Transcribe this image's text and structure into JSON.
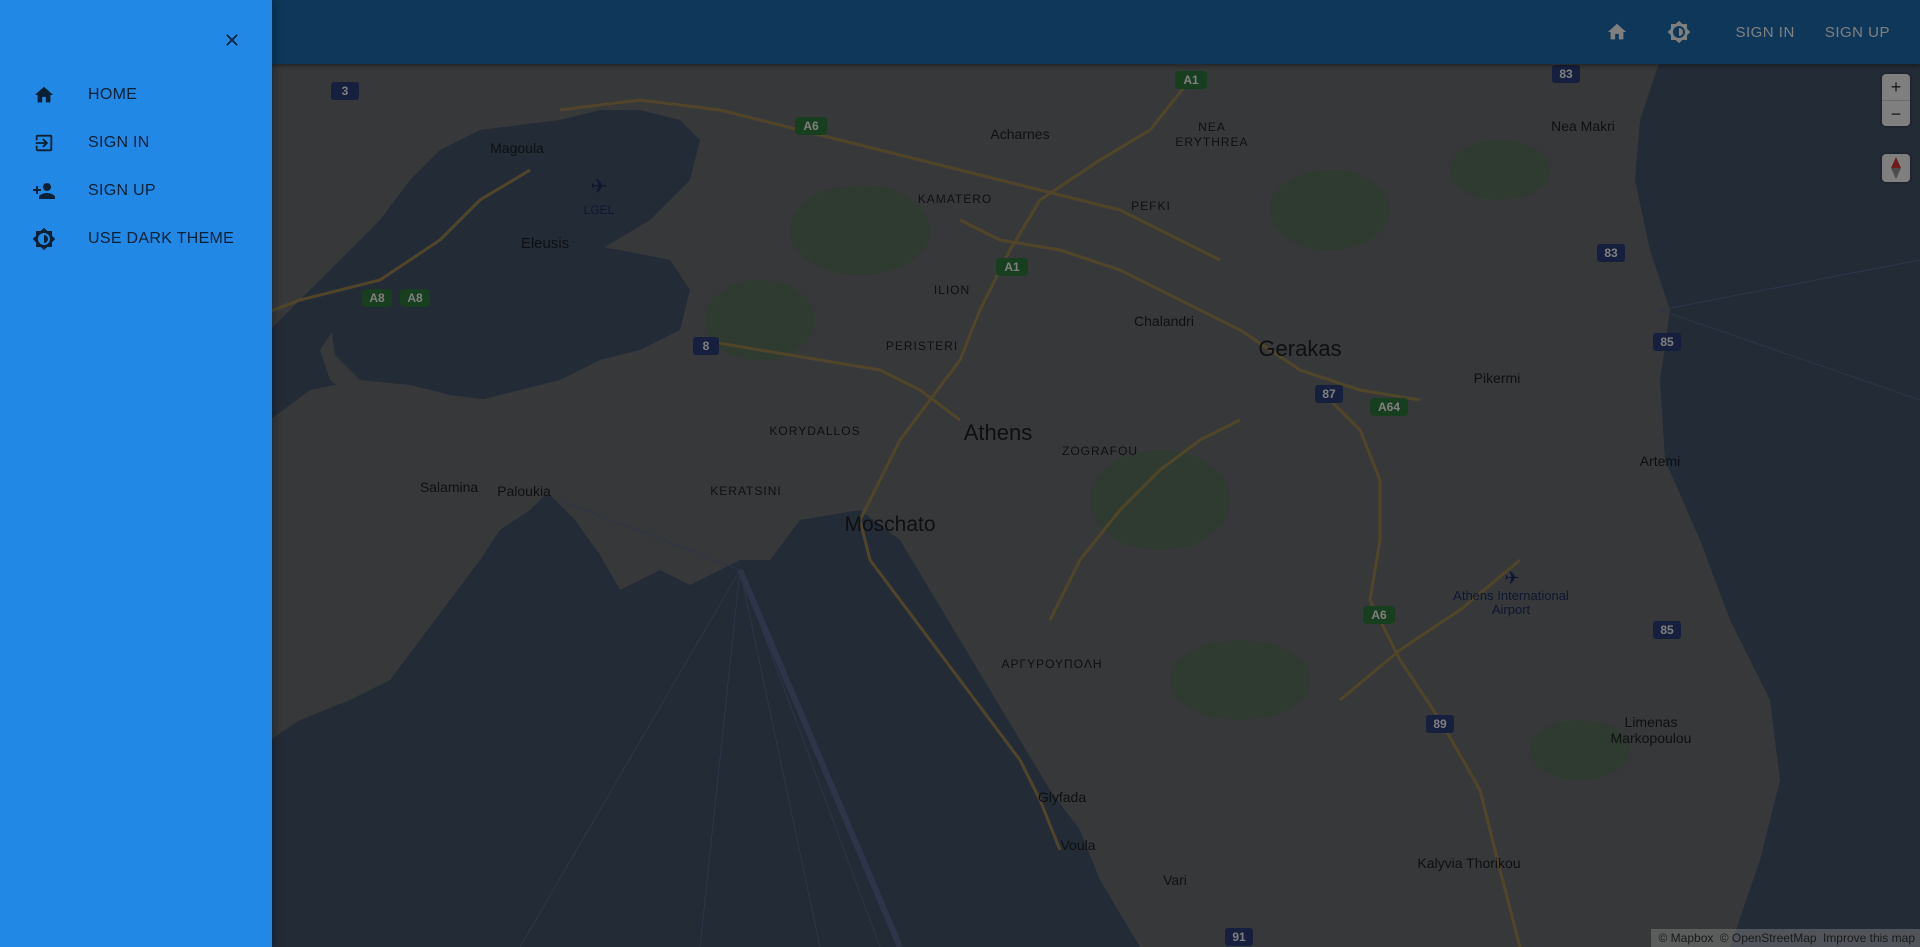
{
  "app_bar": {
    "home_icon": "home-icon",
    "theme_icon": "brightness-icon",
    "sign_in_label": "SIGN IN",
    "sign_up_label": "SIGN UP"
  },
  "drawer": {
    "close_icon": "close-icon",
    "items": [
      {
        "label": "HOME",
        "icon": "home-icon"
      },
      {
        "label": "SIGN IN",
        "icon": "login-icon"
      },
      {
        "label": "SIGN UP",
        "icon": "person-add-icon"
      },
      {
        "label": "USE DARK THEME",
        "icon": "brightness-icon"
      }
    ]
  },
  "map": {
    "zoom_in_label": "+",
    "zoom_out_label": "−",
    "attribution": [
      "© Mapbox",
      "© OpenStreetMap",
      "Improve this map"
    ],
    "places": {
      "athens": "Athens",
      "moschato": "Moschato",
      "gerakas": "Gerakas",
      "acharnes": "Acharnes",
      "nea_erythrea_1": "NEA",
      "nea_erythrea_2": "ERYTHREA",
      "nea_makri": "Nea Makri",
      "magoula": "Magoula",
      "lgel": "LGEL",
      "eleusis": "Eleusis",
      "kamatero": "KAMATERO",
      "pefki": "PEFKI",
      "ilion": "ILION",
      "chalandri": "Chalandri",
      "peristeri": "PERISTERI",
      "pikermi": "Pikermi",
      "korydallos": "KORYDALLOS",
      "zografou": "ZOGRAFOU",
      "salamina": "Salamina",
      "paloukia": "Paloukia",
      "keratsini": "KERATSINI",
      "artemi": "Artemi",
      "airport_1": "Athens International",
      "airport_2": "Airport",
      "argyroupoli": "ΑΡΓΥΡΟΥΠΟΛΗ",
      "limenas_1": "Limenas",
      "limenas_2": "Markopoulou",
      "glyfada": "Glyfada",
      "voula": "Voula",
      "vari": "Vari",
      "kalyvia": "Kalyvia Thorikou"
    },
    "shields": {
      "r3": "3",
      "a1_top": "A1",
      "r83_top": "83",
      "a6_top": "A6",
      "a1_mid": "A1",
      "r83_mid": "83",
      "a8_1": "A8",
      "a8_2": "A8",
      "r8": "8",
      "r85_top": "85",
      "r87": "87",
      "a64": "A64",
      "a6_low": "A6",
      "r85_low": "85",
      "r89": "89",
      "r91": "91"
    },
    "colors": {
      "water": "#47566c",
      "land": "#6e7173",
      "park": "#5e7560",
      "motorway": "#a08b52",
      "motorway_shield": "#2e7d3c",
      "route_shield": "#2d3f7a",
      "app_bar": "#1d6fb5",
      "drawer": "#2189e5"
    }
  }
}
